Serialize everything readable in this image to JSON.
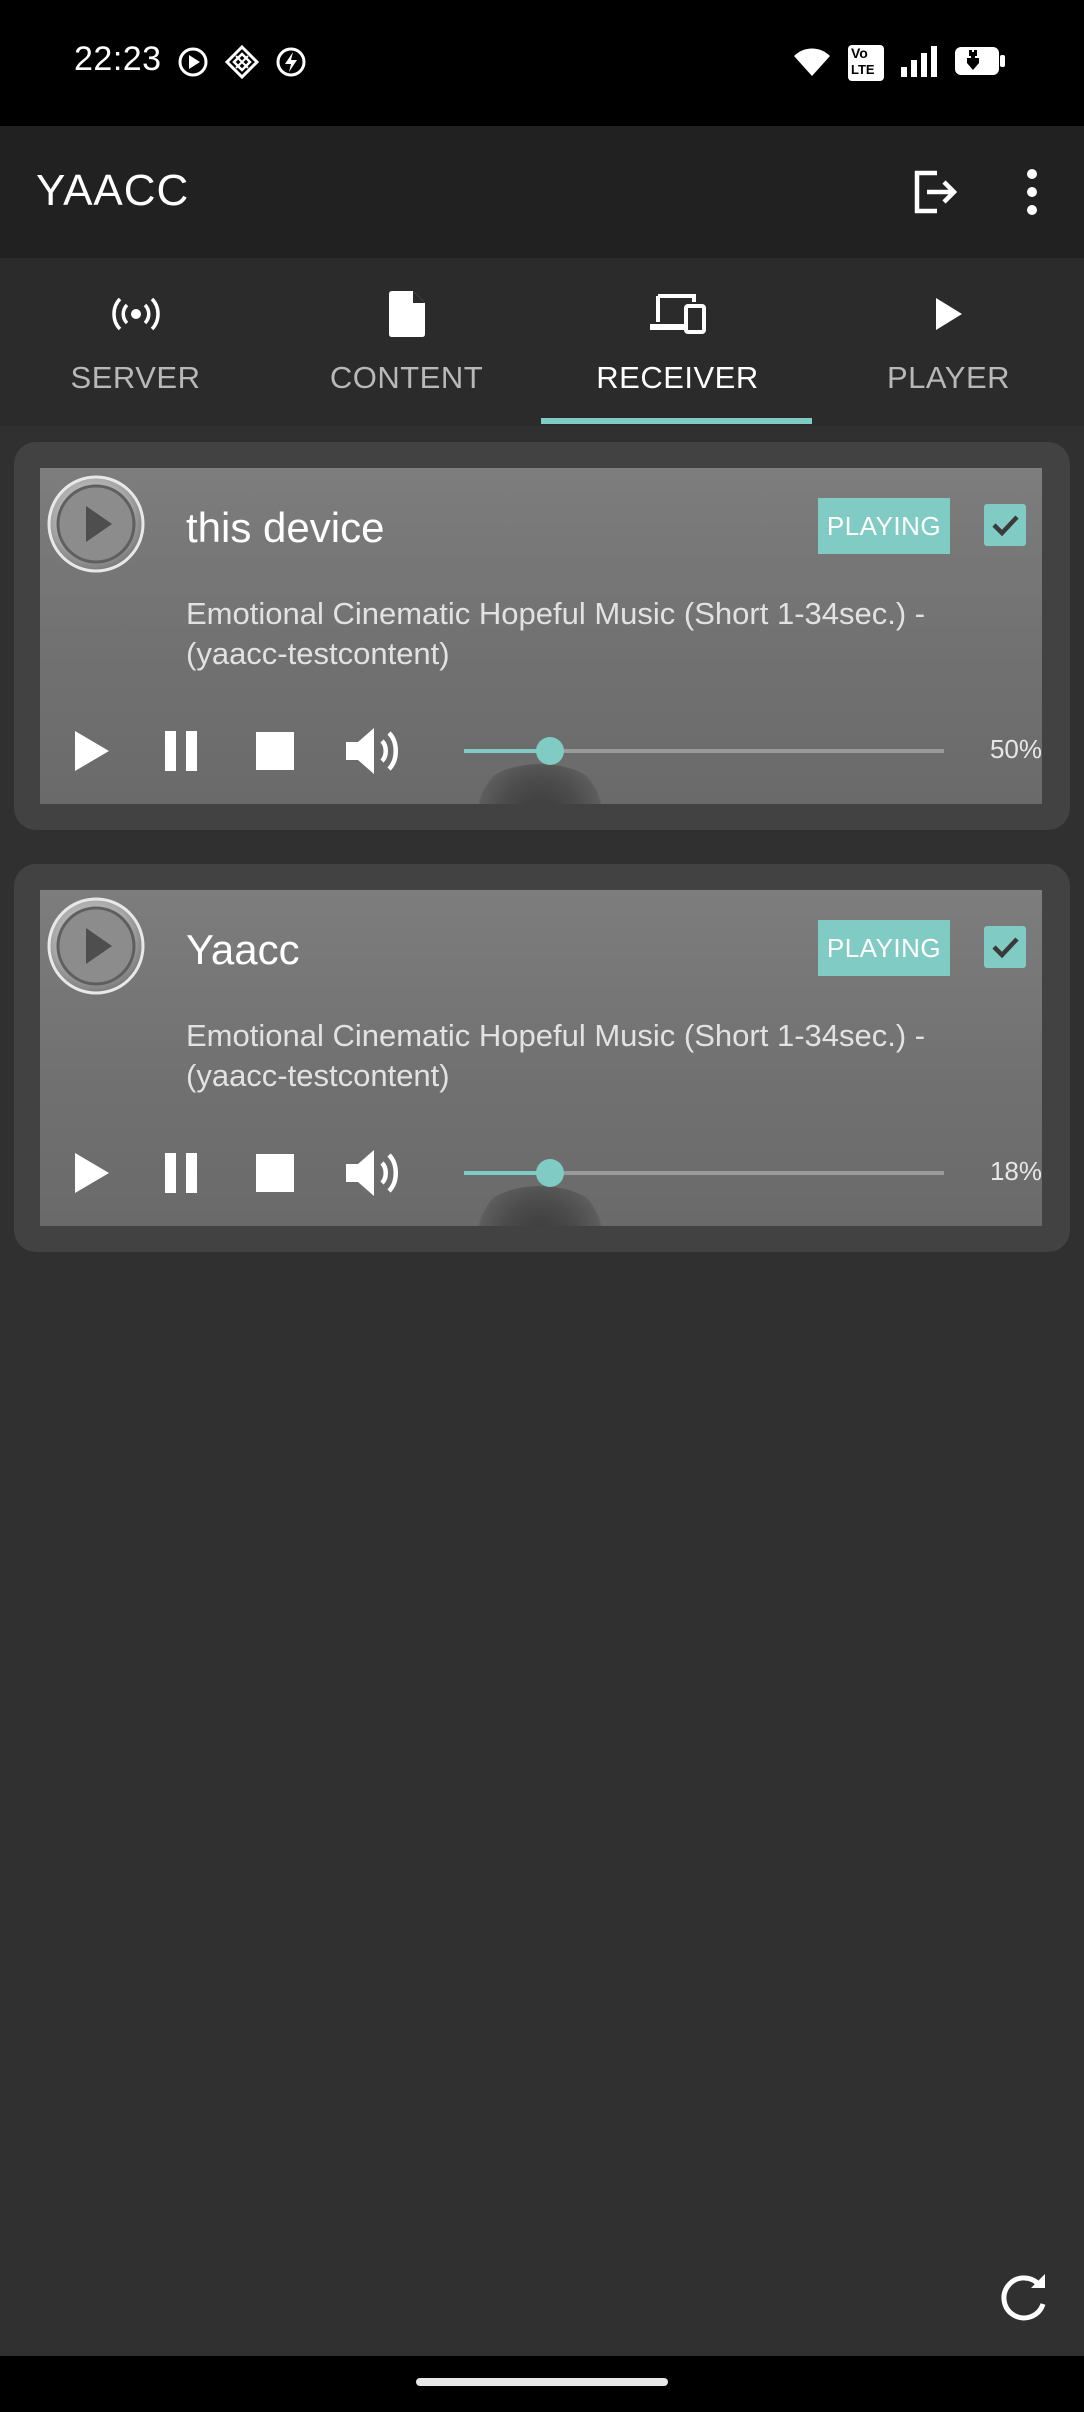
{
  "status_bar": {
    "time": "22:23",
    "left_icons": [
      "media-play-icon",
      "vpn-icon",
      "charging-bolt-icon"
    ],
    "right_icons": [
      "wifi-icon",
      "volte-icon",
      "signal-icon",
      "battery-charging-icon"
    ],
    "volte_label_top": "Vo",
    "volte_label_bottom": "LTE"
  },
  "app_bar": {
    "title": "YAACC",
    "actions": [
      "exit-icon",
      "overflow-menu-icon"
    ]
  },
  "tabs": [
    {
      "label": "SERVER",
      "icon": "broadcast-icon",
      "active": false
    },
    {
      "label": "CONTENT",
      "icon": "document-icon",
      "active": false
    },
    {
      "label": "RECEIVER",
      "icon": "devices-icon",
      "active": true
    },
    {
      "label": "PLAYER",
      "icon": "play-icon",
      "active": false
    }
  ],
  "accent_color": "#80cbc4",
  "receivers": [
    {
      "name": "this device",
      "status": "PLAYING",
      "checked": true,
      "track": "Emotional Cinematic Hopeful Music (Short 1-34sec.) - (yaacc-testcontent)",
      "volume_label": "50%",
      "volume": 0.18
    },
    {
      "name": "Yaacc",
      "status": "PLAYING",
      "checked": true,
      "track": "Emotional Cinematic Hopeful Music (Short 1-34sec.) - (yaacc-testcontent)",
      "volume_label": "18%",
      "volume": 0.18
    }
  ],
  "fab": {
    "icon": "refresh-icon"
  }
}
